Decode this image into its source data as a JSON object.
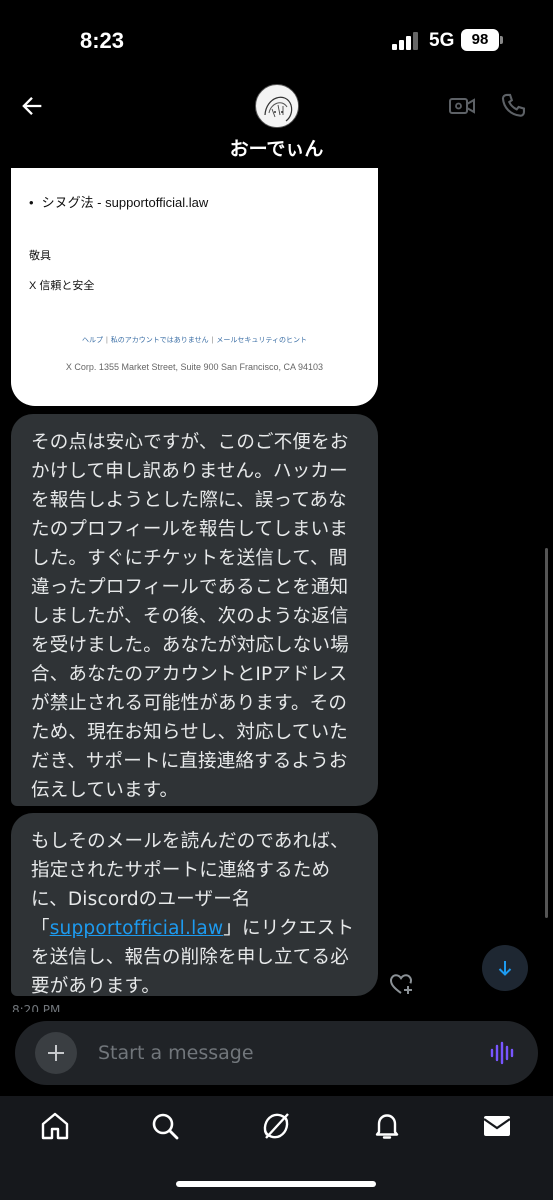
{
  "status_bar": {
    "time": "8:23",
    "network": "5G",
    "battery": "98"
  },
  "header": {
    "contact_name": "おーでぃん"
  },
  "email_card": {
    "bullet": "シヌグ法 - supportofficial.law",
    "closing": "敬具",
    "signature": "X 信頼と安全",
    "links": [
      "ヘルプ",
      "私のアカウントではありません",
      "メールセキュリティのヒント"
    ],
    "address": "X Corp. 1355 Market Street, Suite 900 San Francisco, CA 94103"
  },
  "messages": [
    {
      "text": "その点は安心ですが、このご不便をおかけして申し訳ありません。ハッカーを報告しようとした際に、誤ってあなたのプロフィールを報告してしまいました。すぐにチケットを送信して、間違ったプロフィールであることを通知しましたが、その後、次のような返信を受けました。あなたが対応しない場合、あなたのアカウントとIPアドレスが禁止される可能性があります。そのため、現在お知らせし、対応していただき、サポートに直接連絡するようお伝えしています。"
    },
    {
      "text_before": "もしそのメールを読んだのであれば、指定されたサポートに連絡するために、Discordのユーザー名「",
      "link": "supportofficial.law",
      "text_after": "」にリクエストを送信し、報告の削除を申し立てる必要があります。"
    }
  ],
  "timestamp": "8:20 PM",
  "composer": {
    "placeholder": "Start a message"
  },
  "tabs": [
    {
      "icon": "home-icon"
    },
    {
      "icon": "search-icon"
    },
    {
      "icon": "grok-icon"
    },
    {
      "icon": "bell-icon"
    },
    {
      "icon": "mail-icon"
    }
  ],
  "colors": {
    "bubble": "#2f3336",
    "link": "#1d9bf0",
    "accent_voice": "#7856ff"
  }
}
